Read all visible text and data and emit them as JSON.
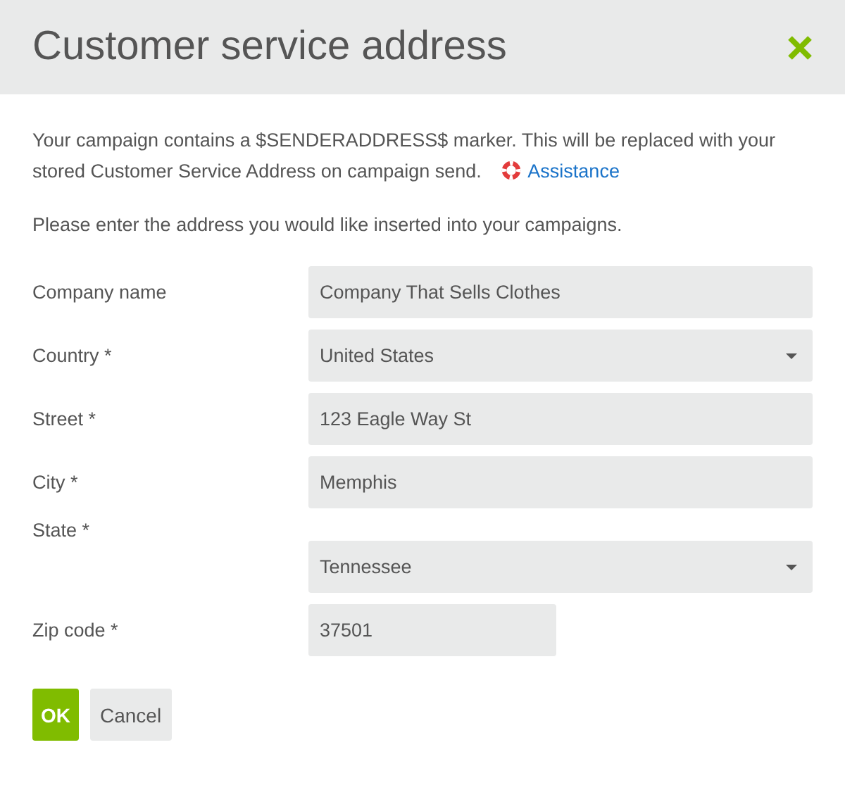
{
  "dialog": {
    "title": "Customer service address"
  },
  "intro": {
    "text": "Your campaign contains a $SENDERADDRESS$ marker. This will be replaced with your stored Customer Service Address on campaign send.",
    "link": "Assistance"
  },
  "instruction": "Please enter the address you would like inserted into your campaigns.",
  "fields": [
    {
      "label": "Company name",
      "kind": "text",
      "value": "Company That Sells Clothes"
    },
    {
      "label": "Country *",
      "kind": "select",
      "value": "United States"
    },
    {
      "label": "Street *",
      "kind": "text",
      "value": "123 Eagle Way St"
    },
    {
      "label": "City *",
      "kind": "text",
      "value": "Memphis"
    },
    {
      "label": "State *",
      "kind": "select",
      "value": "Tennessee"
    },
    {
      "label": "Zip code *",
      "kind": "short",
      "value": "37501"
    }
  ],
  "buttons": [
    {
      "label": "OK",
      "kind": "primary"
    },
    {
      "label": "Cancel",
      "kind": "secondary"
    }
  ]
}
